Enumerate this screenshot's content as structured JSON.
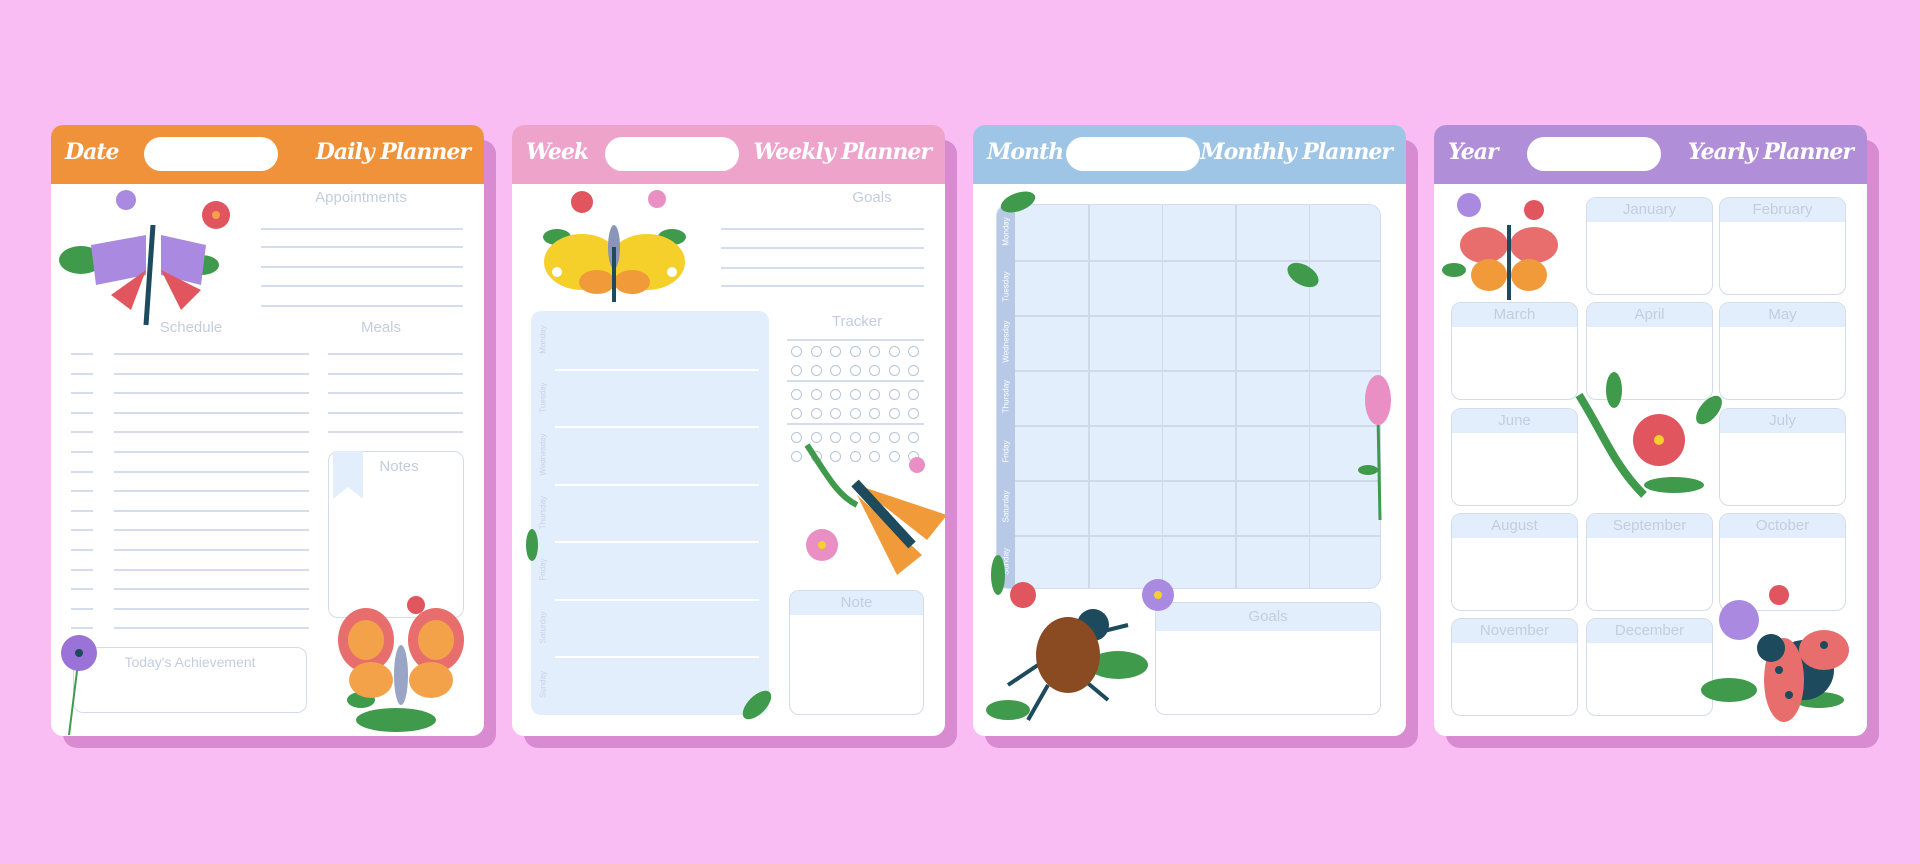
{
  "colors": {
    "background": "#f9bdf3",
    "shadow": "#d98bd2",
    "daily": "#f0923a",
    "weekly": "#eea3cb",
    "monthly": "#9ec5e5",
    "yearly": "#b08fd8",
    "panel": "#e3eefc"
  },
  "daily": {
    "label": "Date",
    "title": "Daily Planner",
    "appointments": "Appointments",
    "schedule": "Schedule",
    "meals": "Meals",
    "notes": "Notes",
    "achievement": "Today's Achievement"
  },
  "weekly": {
    "label": "Week",
    "title": "Weekly Planner",
    "goals": "Goals",
    "tracker": "Tracker",
    "note": "Note",
    "days": [
      "Monday",
      "Tuesday",
      "Wednesday",
      "Thursday",
      "Friday",
      "Saturday",
      "Sunday"
    ]
  },
  "monthly": {
    "label": "Month",
    "title": "Monthly Planner",
    "goals": "Goals",
    "days": [
      "Monday",
      "Tuesday",
      "Wednesday",
      "Thursday",
      "Friday",
      "Saturday",
      "Sunday"
    ]
  },
  "yearly": {
    "label": "Year",
    "title": "Yearly Planner",
    "months": [
      "January",
      "February",
      "March",
      "April",
      "May",
      "June",
      "July",
      "August",
      "September",
      "October",
      "November",
      "December"
    ]
  }
}
